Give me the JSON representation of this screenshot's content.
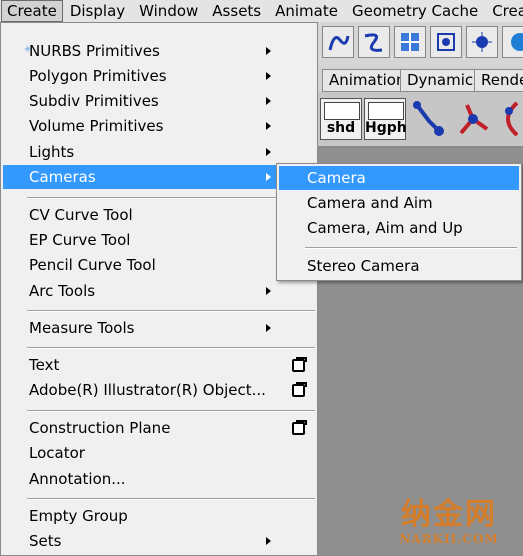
{
  "menubar": {
    "items": [
      "Create",
      "Display",
      "Window",
      "Assets",
      "Animate",
      "Geometry Cache",
      "Crea"
    ]
  },
  "tabs": [
    "Animation",
    "Dynamics",
    "Rende"
  ],
  "shelf": {
    "btn1": "shd",
    "btn2": "Hgph"
  },
  "create_menu": {
    "items": [
      {
        "label": "NURBS Primitives",
        "submenu": true
      },
      {
        "label": "Polygon Primitives",
        "submenu": true
      },
      {
        "label": "Subdiv Primitives",
        "submenu": true
      },
      {
        "label": "Volume Primitives",
        "submenu": true
      },
      {
        "label": "Lights",
        "submenu": true
      },
      {
        "label": "Cameras",
        "submenu": true,
        "highlighted": true
      },
      {
        "label": "CV Curve Tool"
      },
      {
        "label": "EP Curve Tool"
      },
      {
        "label": "Pencil Curve Tool"
      },
      {
        "label": "Arc Tools",
        "submenu": true
      },
      {
        "label": "Measure Tools",
        "submenu": true
      },
      {
        "label": "Text",
        "option_box": true
      },
      {
        "label": "Adobe(R) Illustrator(R) Object...",
        "option_box": true
      },
      {
        "label": "Construction Plane",
        "option_box": true
      },
      {
        "label": "Locator"
      },
      {
        "label": "Annotation..."
      },
      {
        "label": "Empty Group"
      },
      {
        "label": "Sets",
        "submenu": true
      }
    ]
  },
  "cameras_submenu": {
    "items": [
      {
        "label": "Camera",
        "option_box": true,
        "highlighted": true
      },
      {
        "label": "Camera and Aim",
        "option_box": true
      },
      {
        "label": "Camera, Aim and Up",
        "option_box": true
      },
      {
        "label": "Stereo Camera"
      }
    ]
  },
  "watermark": {
    "main": "纳金网",
    "sub": "NARKII.COM"
  },
  "colors": {
    "highlight": "#3399ff",
    "menu_bg": "#f0f0f0",
    "viewport": "#8f8f8f",
    "watermark": "#e07b1a"
  }
}
